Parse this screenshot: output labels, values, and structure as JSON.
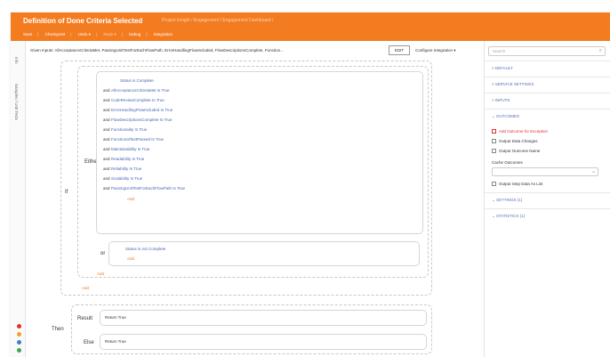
{
  "header": {
    "title": "Definition of Done Criteria Selected",
    "breadcrumb": "Project Insight  /  Engagement  /  Engagement Dashboard  /",
    "menu": [
      "Save",
      "Checkpoint",
      "Undo ▾",
      "Redo ▾",
      "Debug",
      "Integration"
    ]
  },
  "left_strip": {
    "label_top": "Info",
    "label_main": "Samples / Unit Tests"
  },
  "input_bar": {
    "text": "Given Inputs: AllAcceptanceCriteriaMet, PassingUnitTestForEachFlowPath, ErrorHandlingFlowIncluded, FlowDescriptionsComplete, Function...",
    "edit_label": "EDIT",
    "configure_label": "Configure Integration ▾"
  },
  "rule": {
    "if_label": "If",
    "either_label": "Either",
    "or_label": "or",
    "then_label": "Then",
    "result_label": "Result",
    "else_label": "Else",
    "either_conditions": [
      {
        "prefix": "",
        "text": "Status  is  Complete"
      },
      {
        "prefix": "and",
        "text": "AllAcceptanceCriteriaMet  Is True"
      },
      {
        "prefix": "and",
        "text": "CodeReviewComplete  Is True"
      },
      {
        "prefix": "and",
        "text": "ErrorHandlingFlowIncluded  Is True"
      },
      {
        "prefix": "and",
        "text": "FlowDescriptionsComplete  Is True"
      },
      {
        "prefix": "and",
        "text": "Functionality  Is True"
      },
      {
        "prefix": "and",
        "text": "FunctionalTestPassed  Is True"
      },
      {
        "prefix": "and",
        "text": "Maintainability  Is True"
      },
      {
        "prefix": "and",
        "text": "Readability  Is True"
      },
      {
        "prefix": "and",
        "text": "Reliability  Is True"
      },
      {
        "prefix": "and",
        "text": "Scalability  Is True"
      },
      {
        "prefix": "and",
        "text": "PassingUnitTestForEachFlowPath  Is True"
      }
    ],
    "or_condition": "Status  is not  Complete",
    "add_label": "Add",
    "result_value": "Return True",
    "else_value": "Return True"
  },
  "right_panel": {
    "search_placeholder": "Search",
    "sections": [
      "DEFAULT",
      "SERVICE SETTINGS",
      "INPUTS",
      "OUTCOMES"
    ],
    "add_outcome": "Add Outcome for Exception",
    "options": [
      "Output Data Changes",
      "Output Outcome Name"
    ],
    "cache_label": "Cache Outcomes",
    "step_option": "Output Step Data As List",
    "settings_label": "SETTINGS (1)",
    "statistics_label": "STATISTICS (1)"
  },
  "colors": {
    "accent": "#f47c20",
    "link_blue": "#4a67b5"
  }
}
